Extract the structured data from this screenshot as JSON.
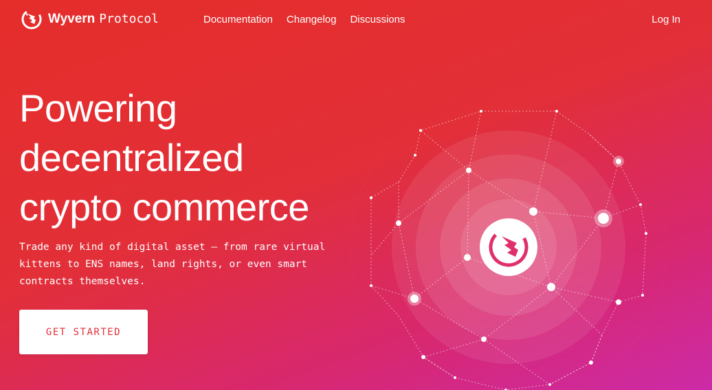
{
  "nav": {
    "brand_name_bold": "Wyvern",
    "brand_name_light": "Protocol",
    "links": [
      "Documentation",
      "Changelog",
      "Discussions"
    ],
    "login": "Log In"
  },
  "hero": {
    "title_lines": [
      "Powering",
      "decentralized",
      "crypto commerce"
    ],
    "subtitle_lines": [
      "Trade any kind of digital asset — from rare virtual",
      "kittens to ENS names, land rights, or even smart",
      "contracts themselves."
    ],
    "cta": "GET STARTED"
  },
  "icons": {
    "brand": "wyvern-dragon-logo-icon",
    "globe_center": "wyvern-dragon-logo-icon"
  },
  "colors": {
    "accent": "#e0303a",
    "bg_start": "#e52d2a",
    "bg_end": "#cc2aa8"
  }
}
